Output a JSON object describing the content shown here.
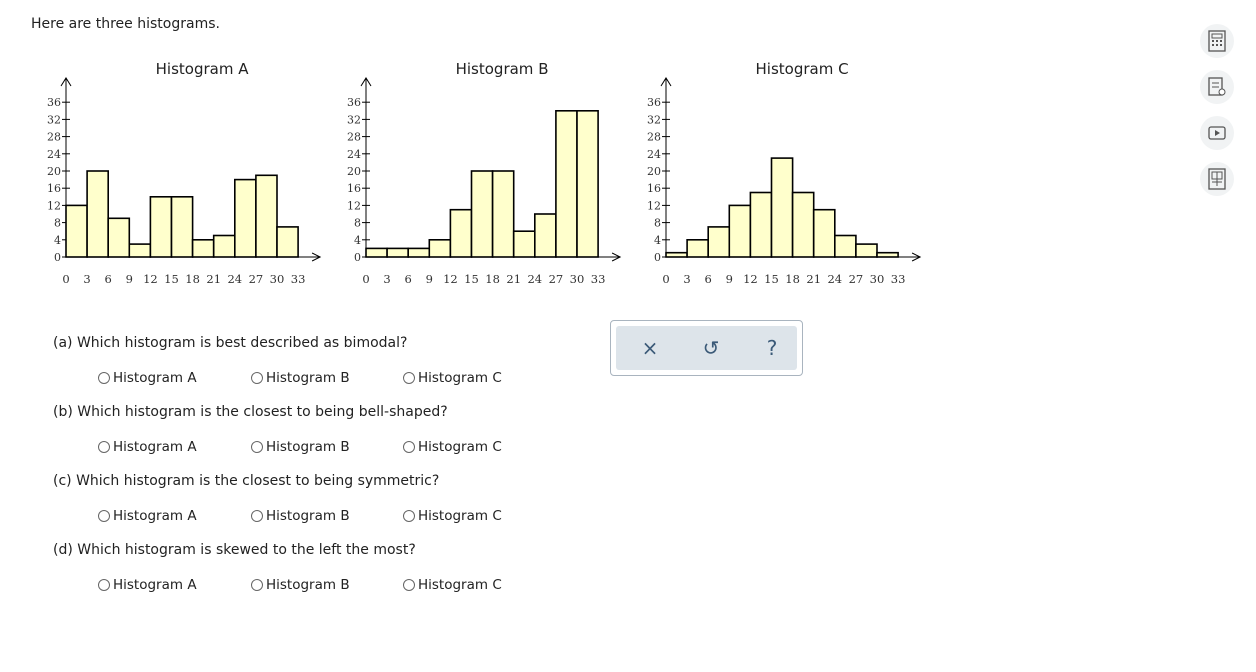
{
  "intro": "Here are three histograms.",
  "chart_data": [
    {
      "type": "bar",
      "title": "Histogram A",
      "bin_edges": [
        0,
        3,
        6,
        9,
        12,
        15,
        18,
        21,
        24,
        27,
        30,
        33
      ],
      "values": [
        12,
        20,
        9,
        3,
        14,
        14,
        4,
        5,
        18,
        19,
        7
      ],
      "yticks": [
        0,
        4,
        8,
        12,
        16,
        20,
        24,
        28,
        32,
        36
      ],
      "xticks": [
        0,
        3,
        6,
        9,
        12,
        15,
        18,
        21,
        24,
        27,
        30,
        33
      ],
      "ylim": [
        0,
        36
      ],
      "bar_color": "#ffffcc"
    },
    {
      "type": "bar",
      "title": "Histogram B",
      "bin_edges": [
        0,
        3,
        6,
        9,
        12,
        15,
        18,
        21,
        24,
        27,
        30,
        33
      ],
      "values": [
        2,
        2,
        2,
        4,
        11,
        20,
        20,
        6,
        10,
        34,
        34
      ],
      "yticks": [
        0,
        4,
        8,
        12,
        16,
        20,
        24,
        28,
        32,
        36
      ],
      "xticks": [
        0,
        3,
        6,
        9,
        12,
        15,
        18,
        21,
        24,
        27,
        30,
        33
      ],
      "ylim": [
        0,
        36
      ],
      "bar_color": "#ffffcc"
    },
    {
      "type": "bar",
      "title": "Histogram C",
      "bin_edges": [
        0,
        3,
        6,
        9,
        12,
        15,
        18,
        21,
        24,
        27,
        30,
        33
      ],
      "values": [
        1,
        4,
        7,
        12,
        15,
        23,
        15,
        11,
        5,
        3,
        1
      ],
      "yticks": [
        0,
        4,
        8,
        12,
        16,
        20,
        24,
        28,
        32,
        36
      ],
      "xticks": [
        0,
        3,
        6,
        9,
        12,
        15,
        18,
        21,
        24,
        27,
        30,
        33
      ],
      "ylim": [
        0,
        36
      ],
      "bar_color": "#ffffcc"
    }
  ],
  "questions": [
    {
      "text": "(a) Which histogram is best described as bimodal?",
      "options": [
        "Histogram A",
        "Histogram B",
        "Histogram C"
      ]
    },
    {
      "text": "(b) Which histogram is the closest to being bell-shaped?",
      "options": [
        "Histogram A",
        "Histogram B",
        "Histogram C"
      ]
    },
    {
      "text": "(c) Which histogram is the closest to being symmetric?",
      "options": [
        "Histogram A",
        "Histogram B",
        "Histogram C"
      ]
    },
    {
      "text": "(d) Which histogram is skewed to the left the most?",
      "options": [
        "Histogram A",
        "Histogram B",
        "Histogram C"
      ]
    }
  ],
  "answer_panel": {
    "clear": "×",
    "undo": "↺",
    "help": "?"
  },
  "sidebar_icons": [
    "calculator-icon",
    "notes-icon",
    "video-icon",
    "textbook-icon"
  ]
}
